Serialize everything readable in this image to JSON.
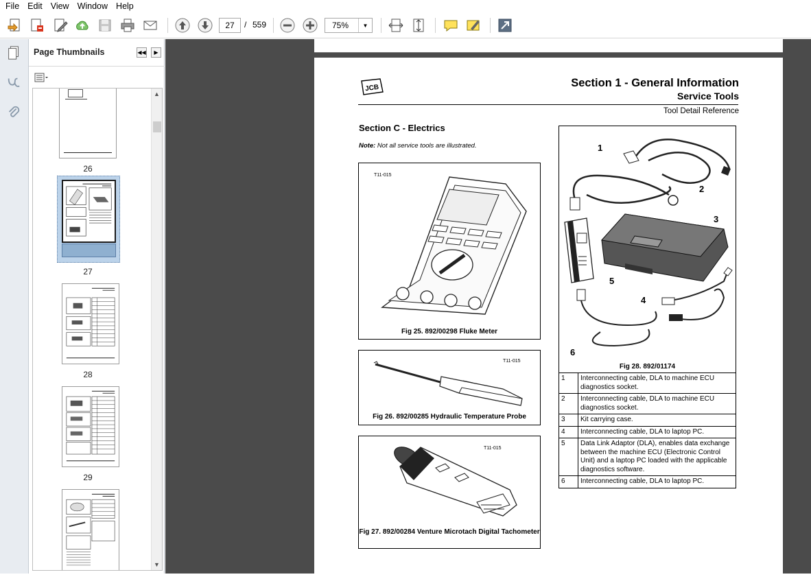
{
  "menu": [
    "File",
    "Edit",
    "View",
    "Window",
    "Help"
  ],
  "toolbar": {
    "current_page": "27",
    "page_separator": "/",
    "total_pages": "559",
    "zoom": "75%",
    "icons": [
      "create-pdf-icon",
      "export-icon",
      "edit-icon",
      "cloud-upload-icon",
      "save-icon",
      "print-icon",
      "email-icon",
      "previous-page-icon",
      "next-page-icon",
      "zoom-out-icon",
      "zoom-in-icon",
      "fit-page-icon",
      "fit-width-icon",
      "comment-icon",
      "highlight-icon",
      "expand-icon"
    ]
  },
  "sidebar": {
    "title": "Page Thumbnails",
    "thumbnails": [
      {
        "number": "26"
      },
      {
        "number": "27",
        "selected": true
      },
      {
        "number": "28"
      },
      {
        "number": "29"
      },
      {
        "number": ""
      }
    ]
  },
  "document": {
    "header": {
      "section": "Section 1 - General Information",
      "title": "Service Tools",
      "subtitle": "Tool Detail Reference"
    },
    "section_title": "Section C - Electrics",
    "note_label": "Note:",
    "note_text": " Not all service tools are illustrated.",
    "figures": [
      {
        "ref": "T11-015",
        "caption": "Fig 25. 892/00298 Fluke Meter"
      },
      {
        "ref": "T11-015",
        "caption": "Fig 26. 892/00285 Hydraulic Temperature Probe"
      },
      {
        "ref": "T11-015",
        "caption": "Fig 27. 892/00284 Venture Microtach Digital Tachometer"
      },
      {
        "caption": "Fig 28. 892/01174",
        "callouts": [
          "1",
          "2",
          "3",
          "4",
          "5",
          "6"
        ]
      }
    ],
    "legend_rows": [
      {
        "num": "1",
        "text": "Interconnecting cable, DLA to machine ECU diagnostics socket."
      },
      {
        "num": "2",
        "text": "Interconnecting cable, DLA to machine ECU diagnostics socket."
      },
      {
        "num": "3",
        "text": "Kit carrying case."
      },
      {
        "num": "4",
        "text": "Interconnecting cable, DLA to laptop PC."
      },
      {
        "num": "5",
        "text": "Data Link Adaptor (DLA), enables data exchange between the machine ECU (Electronic Control Unit) and a laptop PC loaded with the applicable diagnostics software."
      },
      {
        "num": "6",
        "text": "Interconnecting cable, DLA to laptop PC."
      }
    ]
  }
}
